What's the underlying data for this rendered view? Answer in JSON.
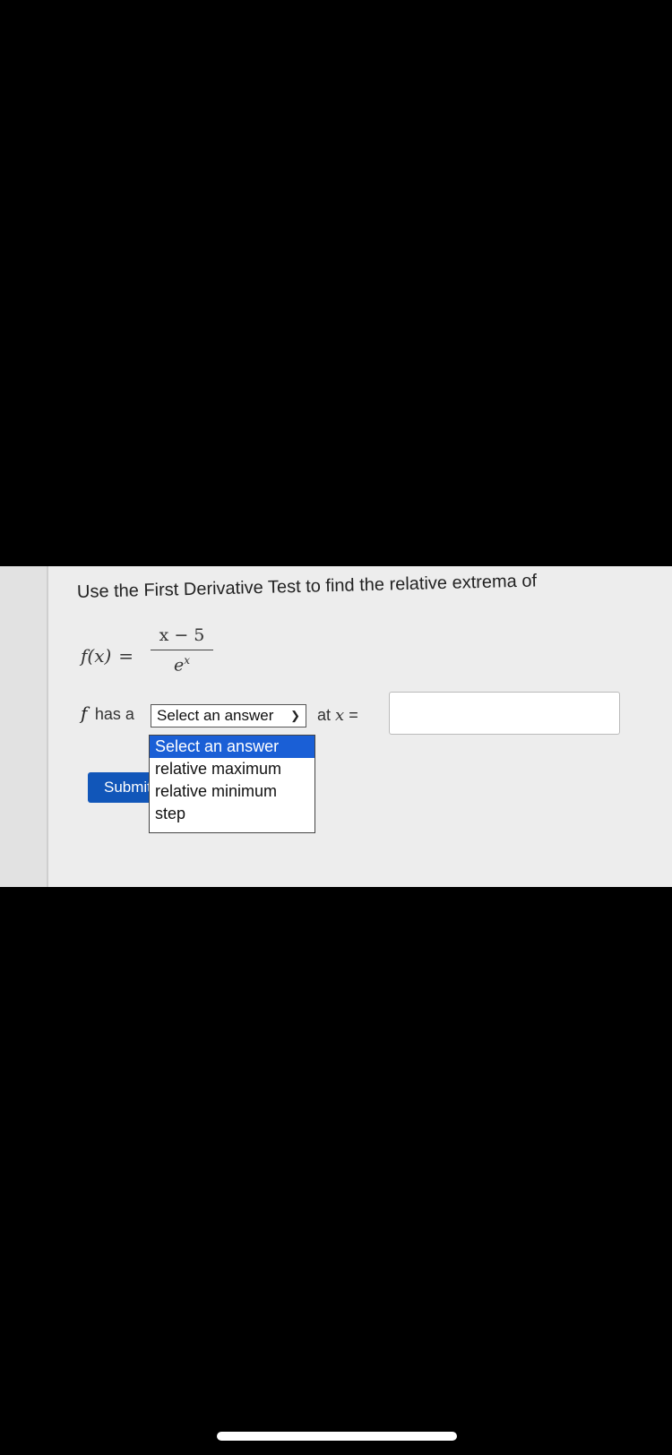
{
  "question": {
    "text": "Use the First Derivative Test to find the relative extrema of"
  },
  "formula": {
    "lhs": "f(x)",
    "equals": "=",
    "numerator": "x − 5",
    "denominator_base": "e",
    "denominator_exp": "x"
  },
  "answer_row": {
    "f_symbol": "f",
    "has_a": "has a",
    "select_value": "Select an answer",
    "at_label": "at",
    "x_symbol": "x",
    "equals": "="
  },
  "dropdown": {
    "options": [
      "Select an answer",
      "relative maximum",
      "relative minimum",
      "step"
    ],
    "highlighted": "Select an answer"
  },
  "submit": {
    "label": "Submit"
  },
  "x_input": {
    "value": ""
  },
  "colors": {
    "accent": "#1156b9",
    "highlight": "#1a5fd6"
  }
}
